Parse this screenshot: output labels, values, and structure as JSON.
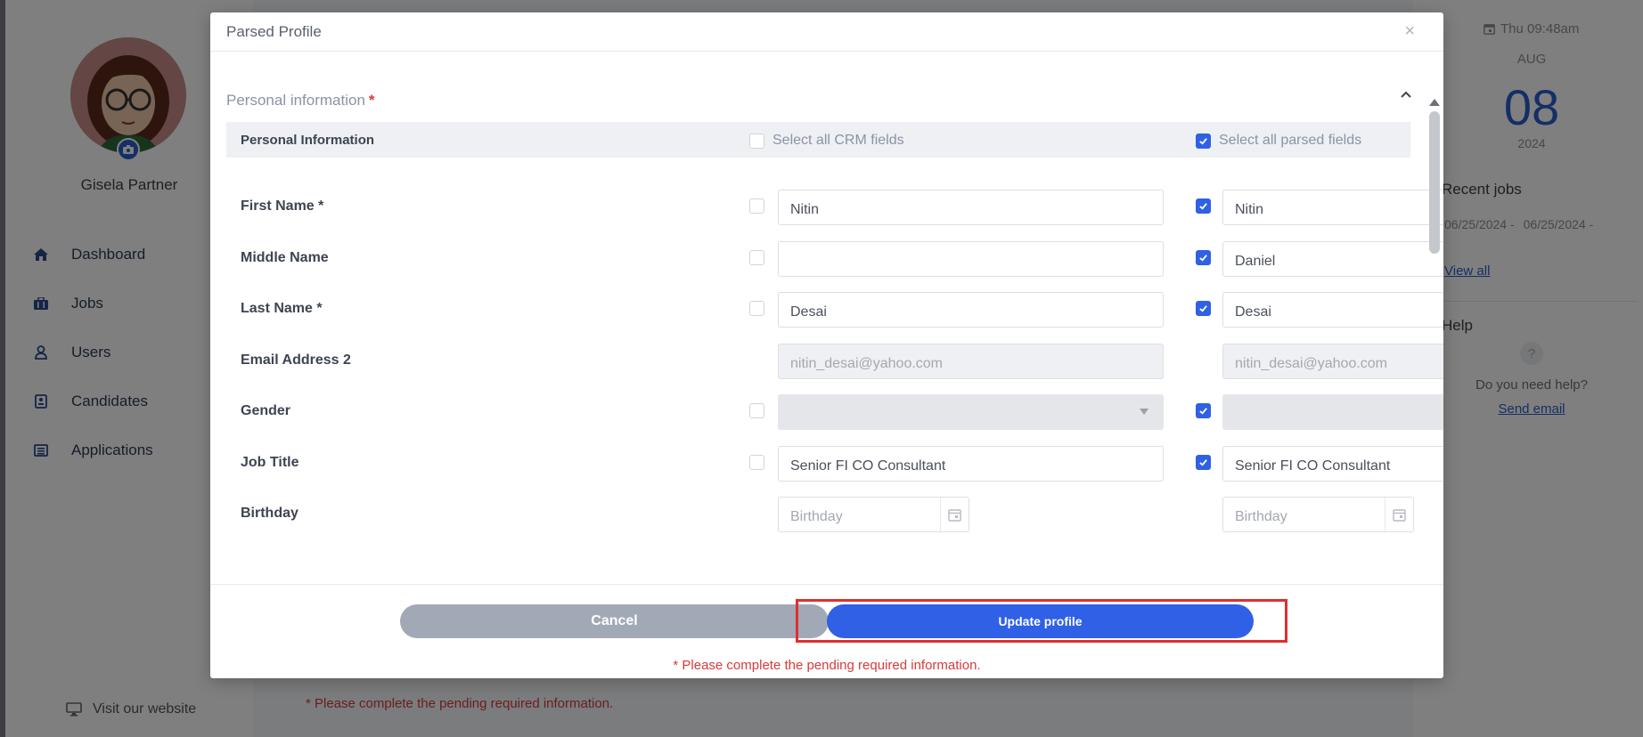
{
  "sidebar": {
    "user_name": "Gisela Partner",
    "nav": [
      {
        "label": "Dashboard",
        "icon": "home-icon"
      },
      {
        "label": "Jobs",
        "icon": "briefcase-icon"
      },
      {
        "label": "Users",
        "icon": "user-icon"
      },
      {
        "label": "Candidates",
        "icon": "candidate-icon"
      },
      {
        "label": "Applications",
        "icon": "list-icon"
      }
    ],
    "visit_website": "Visit our website"
  },
  "background": {
    "warning": "* Please complete the pending required information."
  },
  "right_panel": {
    "date_line": "Thu 09:48am",
    "month": "AUG",
    "day": "08",
    "year": "2024",
    "recent_jobs_title": "Recent jobs",
    "recent_job_dates": [
      "06/25/2024 -",
      "06/25/2024 -"
    ],
    "view_all": "View all",
    "help_title": "Help",
    "help_text": "Do you need help?",
    "send_email": "Send email"
  },
  "modal": {
    "title": "Parsed Profile",
    "close_glyph": "×",
    "section_title": "Personal information",
    "required_mark": "*",
    "grid_header": {
      "label": "Personal Information",
      "select_crm": "Select all CRM fields",
      "select_crm_checked": false,
      "select_parsed": "Select all parsed fields",
      "select_parsed_checked": true
    },
    "fields": {
      "first_name": {
        "label": "First Name *",
        "crm_value": "Nitin",
        "parsed_value": "Nitin",
        "crm_checked": false,
        "parsed_checked": true
      },
      "middle_name": {
        "label": "Middle Name",
        "crm_value": "",
        "parsed_value": "Daniel",
        "crm_checked": false,
        "parsed_checked": true
      },
      "last_name": {
        "label": "Last Name *",
        "crm_value": "Desai",
        "parsed_value": "Desai",
        "crm_checked": false,
        "parsed_checked": true
      },
      "email2": {
        "label": "Email Address 2",
        "crm_value": "nitin_desai@yahoo.com",
        "parsed_value": "nitin_desai@yahoo.com"
      },
      "gender": {
        "label": "Gender",
        "crm_value": "",
        "parsed_value": "",
        "crm_checked": false,
        "parsed_checked": true
      },
      "job_title": {
        "label": "Job Title",
        "crm_value": "Senior FI CO Consultant",
        "parsed_value": "Senior FI CO Consultant",
        "crm_checked": false,
        "parsed_checked": true
      },
      "birthday": {
        "label": "Birthday",
        "crm_placeholder": "Birthday",
        "parsed_placeholder": "Birthday"
      }
    },
    "footer": {
      "cancel": "Cancel",
      "update": "Update profile",
      "warning": "* Please complete the pending required information."
    }
  },
  "colors": {
    "accent": "#2f60e6",
    "cancel_button": "#a2a9b6",
    "error": "#d73a3a",
    "highlight": "#e12e2e"
  }
}
